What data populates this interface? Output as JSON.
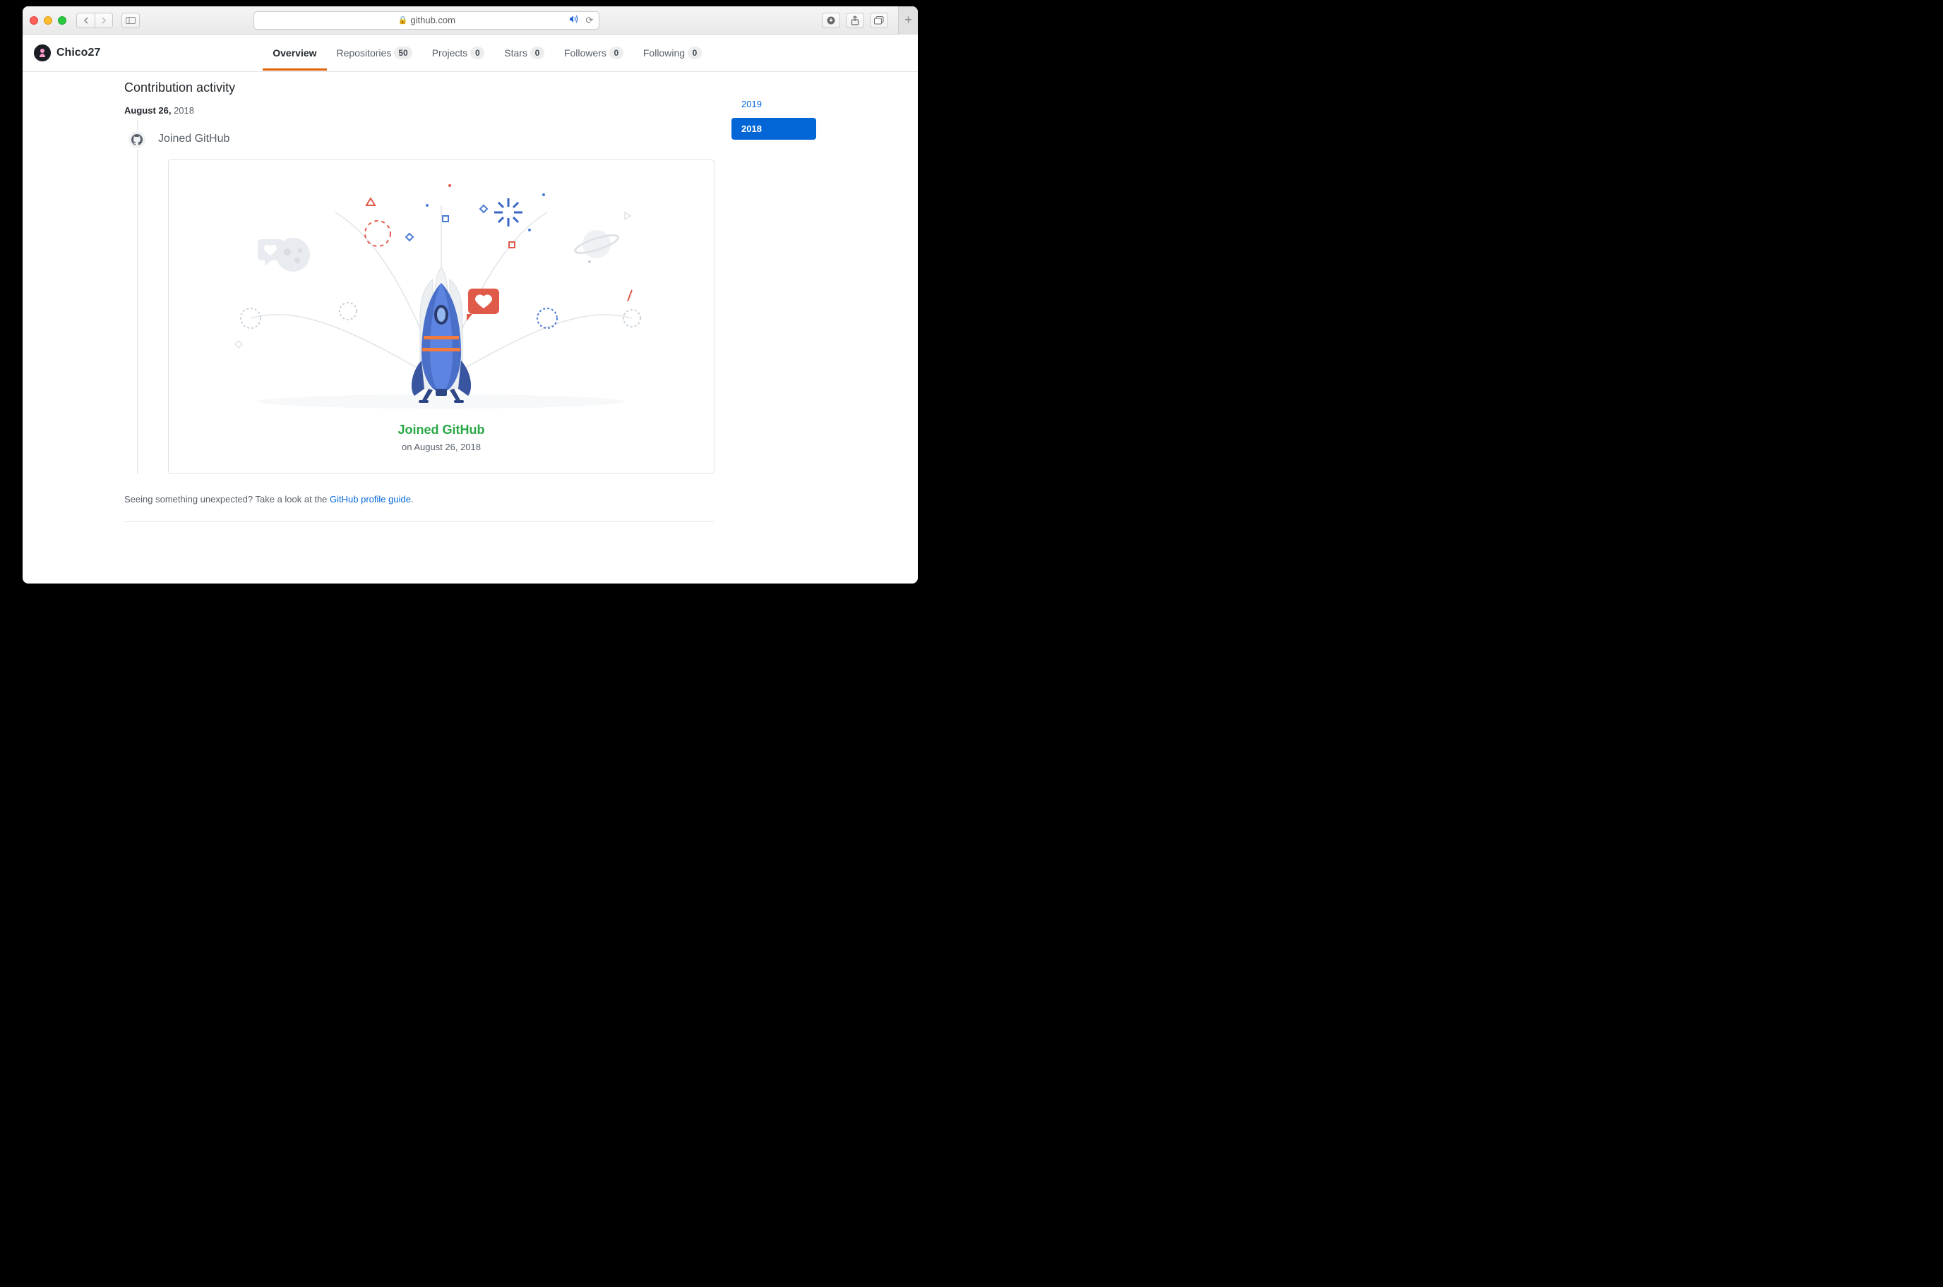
{
  "browser": {
    "host": "github.com"
  },
  "header": {
    "username": "Chico27",
    "tabs": [
      {
        "label": "Overview",
        "count": null,
        "active": true
      },
      {
        "label": "Repositories",
        "count": "50",
        "active": false
      },
      {
        "label": "Projects",
        "count": "0",
        "active": false
      },
      {
        "label": "Stars",
        "count": "0",
        "active": false
      },
      {
        "label": "Followers",
        "count": "0",
        "active": false
      },
      {
        "label": "Following",
        "count": "0",
        "active": false
      }
    ]
  },
  "activity": {
    "heading": "Contribution activity",
    "date_prefix": "August 26,",
    "date_year": " 2018",
    "joined_label": "Joined GitHub",
    "card": {
      "title": "Joined GitHub",
      "subtitle": "on August 26, 2018"
    },
    "footer_text": "Seeing something unexpected? Take a look at the ",
    "footer_link": "GitHub profile guide",
    "footer_suffix": "."
  },
  "years": [
    {
      "label": "2019",
      "selected": false
    },
    {
      "label": "2018",
      "selected": true
    }
  ]
}
